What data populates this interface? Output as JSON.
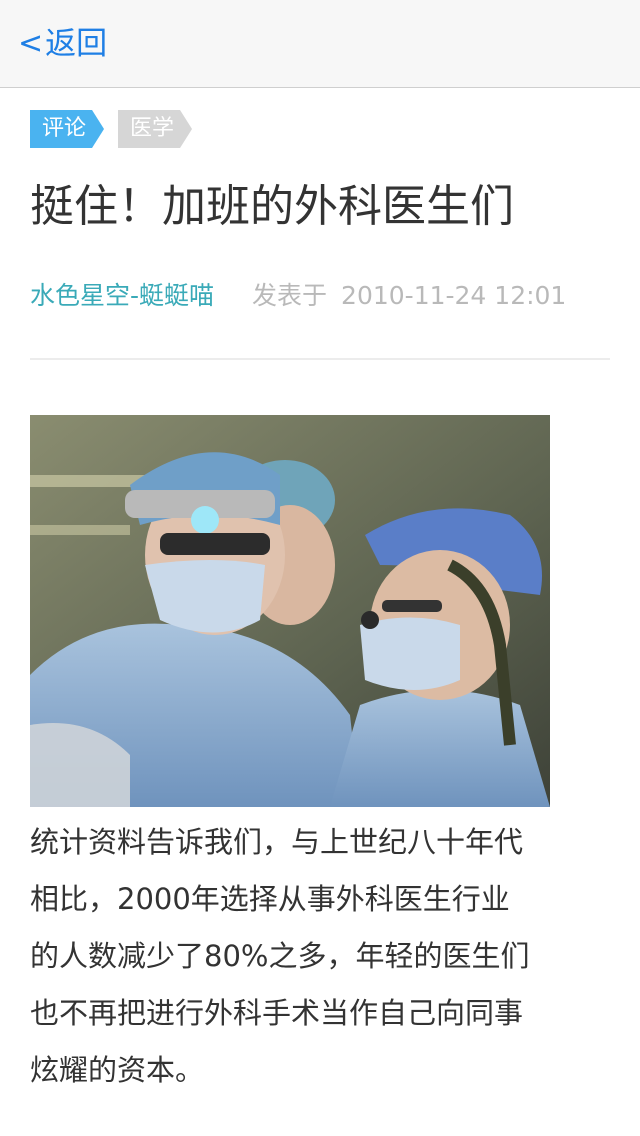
{
  "navbar": {
    "back_chevron": "<",
    "back_label": "返回"
  },
  "article": {
    "tags": [
      "评论",
      "医学"
    ],
    "title": "挺住！加班的外科医生们",
    "author": "水色星空-蜓蜓喵",
    "posted_label": "发表于",
    "date": "2010-11-24 12:01",
    "body_lines": [
      "统计资料告诉我们，与上世纪八十年代",
      "相比，2000年选择从事外科医生行业",
      "的人数减少了80%之多，年轻的医生们",
      "也不再把进行外科手术当作自己向同事",
      "炫耀的资本。"
    ]
  },
  "colors": {
    "link_blue": "#1f7fe5",
    "tag_blue": "#4ab3f0",
    "tag_gray": "#d6d6d6",
    "author_teal": "#3aaab8",
    "meta_gray": "#b9b9b9"
  }
}
